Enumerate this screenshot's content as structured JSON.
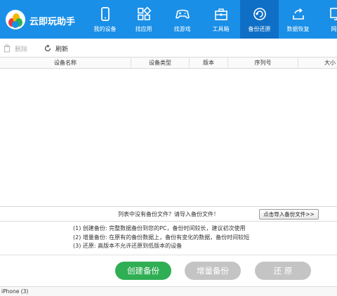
{
  "app": {
    "brand": "云即玩助手"
  },
  "nav": [
    {
      "label": "我的设备",
      "icon": "phone-icon"
    },
    {
      "label": "找应用",
      "icon": "apps-icon"
    },
    {
      "label": "找游戏",
      "icon": "gamepad-icon"
    },
    {
      "label": "工具箱",
      "icon": "toolbox-icon"
    },
    {
      "label": "备份还原",
      "icon": "backup-icon",
      "active": true
    },
    {
      "label": "数据恢复",
      "icon": "restore-icon"
    },
    {
      "label": "网页",
      "icon": "web-icon"
    }
  ],
  "toolbar": {
    "delete_label": "删除",
    "refresh_label": "刷新"
  },
  "table": {
    "columns": [
      "设备名称",
      "设备类型",
      "版本",
      "序列号",
      "大小"
    ],
    "rows": []
  },
  "import": {
    "hint": "列表中没有备份文件？请导入备份文件！",
    "button_label": "点击导入备份文件>>"
  },
  "notes": [
    "(1) 创建备份: 完整数据备份到您的PC，备份时间较长，建议初次使用",
    "(2) 增量备份: 在原有的备份数据上，备份有变化的数据，备份时间较短",
    "(3) 还原: 高版本不允许还原到低版本的设备"
  ],
  "actions": {
    "create_label": "创建备份",
    "incremental_label": "增量备份",
    "restore_label": "还 原"
  },
  "status": {
    "device_text": "iPhone (3)"
  },
  "colors": {
    "nav_bg": "#1a8fe7",
    "nav_active": "#0f6fc6",
    "create_button": "#2fae54",
    "disabled_button": "#c4c4c4"
  }
}
